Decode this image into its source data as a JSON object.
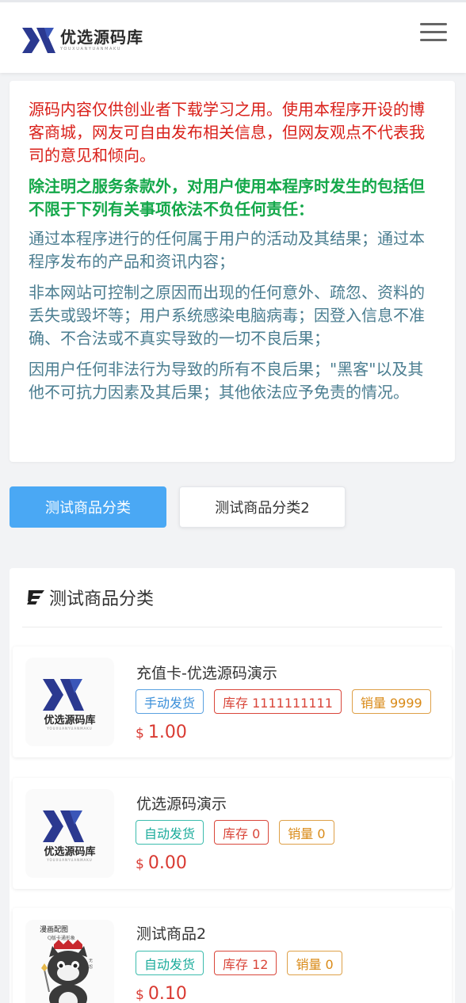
{
  "header": {
    "logo_name": "优选源码库",
    "logo_sub": "YOUXUANYUANMAKU",
    "menu_icon": "hamburger-icon"
  },
  "notice": {
    "red": "源码内容仅供创业者下载学习之用。使用本程序开设的博客商城，网友可自由发布相关信息，但网友观点不代表我司的意见和倾向。",
    "green": "除注明之服务条款外，对用户使用本程序时发生的包括但不限于下列有关事项依法不负任何责任：",
    "items": [
      "通过本程序进行的任何属于用户的活动及其结果；通过本程序发布的产品和资讯内容；",
      "非本网站可控制之原因而出现的任何意外、疏忽、资料的丢失或毁坏等；用户系统感染电脑病毒；因登入信息不准确、不合法或不真实导致的一切不良后果；",
      "因用户任何非法行为导致的所有不良后果；\"黑客\"以及其他不可抗力因素及其后果；其他依法应予免责的情况。"
    ],
    "colors": {
      "red": "#d9201a",
      "green": "#14a84a",
      "blue": "#4a7d90"
    }
  },
  "tabs": [
    {
      "label": "测试商品分类",
      "active": true
    },
    {
      "label": "测试商品分类2",
      "active": false
    }
  ],
  "category": {
    "title": "测试商品分类",
    "icon": "css3-icon"
  },
  "products": [
    {
      "name": "充值卡-优选源码演示",
      "image": "logo-image",
      "delivery": "手动发货",
      "stock": "库存 1111111111",
      "sales": "销量 9999",
      "currency": "$",
      "price": "1.00"
    },
    {
      "name": "优选源码演示",
      "image": "logo-image",
      "delivery": "自动发货",
      "stock": "库存 0",
      "sales": "销量 0",
      "currency": "$",
      "price": "0.00"
    },
    {
      "name": "测试商品2",
      "image": "cat-image",
      "delivery": "自动发货",
      "stock": "库存 12",
      "sales": "销量 0",
      "currency": "$",
      "price": "0.10"
    }
  ],
  "brand_colors": {
    "accent": "#4aa8f4",
    "logo": "#2b3990",
    "price": "#d93a32"
  }
}
